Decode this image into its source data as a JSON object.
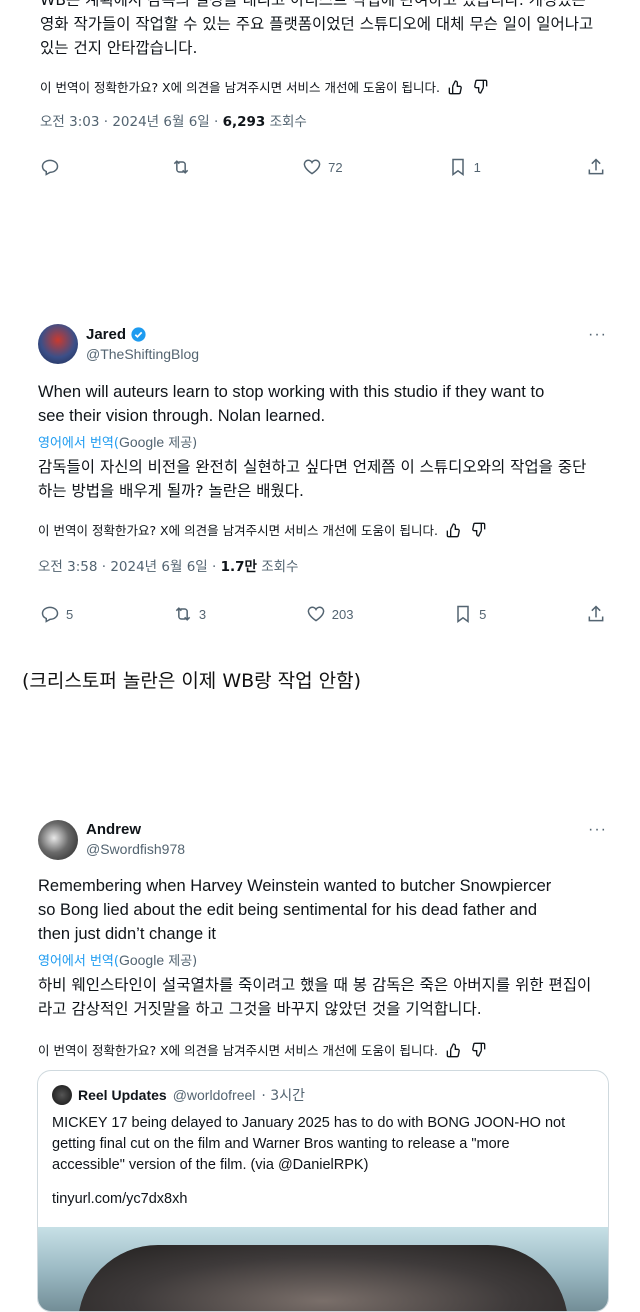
{
  "tweet1": {
    "text_line1": "WB는 계획에서 감독의 결정을 내리고 아티스트 작업에 관여하고 있습니다. 개성있는",
    "text_line2": "영화 작가들이 작업할 수 있는 주요 플랫폼이었던 스튜디오에 대체 무슨 일이 일어나고",
    "text_line3": "있는 건지 안타깝습니다.",
    "feedback": "이 번역이 정확한가요? X에 의견을 남겨주시면 서비스 개선에 도움이 됩니다.",
    "time": "오전 3:03 · 2024년 6월 6일 · ",
    "views": "6,293",
    "views_label": " 조회수",
    "actions": {
      "reply": "",
      "retweet": "",
      "like": "72",
      "bookmark": "1"
    }
  },
  "tweet2": {
    "name": "Jared",
    "handle": "@TheShiftingBlog",
    "text_en_line1": "When will auteurs learn to stop working with this studio if they want to",
    "text_en_line2": "see their vision through.  Nolan learned.",
    "translate_prefix": "영어에서 번역(",
    "translate_google": "Google",
    "translate_suffix": " 제공)",
    "text_ko_line1": "감독들이 자신의 비전을 완전히 실현하고 싶다면 언제쯤 이 스튜디오와의 작업을 중단",
    "text_ko_line2": "하는 방법을 배우게 될까? 놀란은 배웠다.",
    "feedback": "이 번역이 정확한가요? X에 의견을 남겨주시면 서비스 개선에 도움이 됩니다.",
    "time": "오전 3:58 · 2024년 6월 6일 · ",
    "views": "1.7만",
    "views_label": " 조회수",
    "actions": {
      "reply": "5",
      "retweet": "3",
      "like": "203",
      "bookmark": "5"
    }
  },
  "caption": "(크리스토퍼 놀란은 이제 WB랑 작업 안함)",
  "tweet3": {
    "name": "Andrew",
    "handle": "@Swordfish978",
    "text_en_line1": "Remembering when Harvey Weinstein wanted to butcher Snowpiercer",
    "text_en_line2": "so Bong lied about the edit being sentimental for his dead father and",
    "text_en_line3": "then just didn’t change it",
    "translate_prefix": "영어에서 번역(",
    "translate_google": "Google",
    "translate_suffix": " 제공)",
    "text_ko_line1": "하비 웨인스타인이 설국열차를 죽이려고 했을 때 봉 감독은 죽은 아버지를 위한 편집이",
    "text_ko_line2": "라고 감상적인 거짓말을 하고 그것을 바꾸지 않았던 것을 기억합니다.",
    "feedback": "이 번역이 정확한가요? X에 의견을 남겨주시면 서비스 개선에 도움이 됩니다.",
    "quote": {
      "name": "Reel Updates",
      "handle": "@worldofreel",
      "time": " · 3시간",
      "text_line1": "MICKEY 17 being delayed to January 2025 has to do with BONG JOON-HO not",
      "text_line2": "getting final cut on the film and Warner Bros wanting to release a \"more",
      "text_line3": "accessible\" version of the film. (via @DanielRPK)",
      "link": "tinyurl.com/yc7dx8xh"
    }
  },
  "colors": {
    "accent": "#1d9bf0",
    "muted": "#536471",
    "text": "#0f1419",
    "border": "#cfd9de"
  },
  "icons": [
    "reply-icon",
    "retweet-icon",
    "heart-icon",
    "bookmark-icon",
    "share-icon",
    "thumbs-up-icon",
    "thumbs-down-icon",
    "verified-badge-icon",
    "more-icon"
  ]
}
